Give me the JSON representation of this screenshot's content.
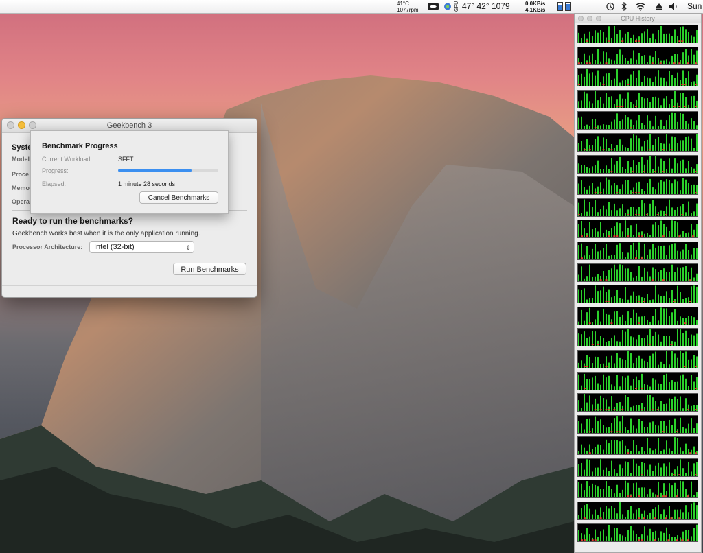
{
  "menubar": {
    "temp_top": "41°C",
    "temp_bottom": "1077rpm",
    "temps": "47° 42° 1079",
    "net_up": "0.0KB/s",
    "net_down": "4.1KB/s",
    "day": "Sun",
    "icons": [
      "nvidia-icon",
      "app-icon",
      "gpu-icon",
      "time-machine-icon",
      "bluetooth-icon",
      "wifi-icon",
      "eject-icon",
      "volume-icon"
    ]
  },
  "cpu_history": {
    "title": "CPU History",
    "core_count": 24,
    "bar_color": "#2bd12b"
  },
  "geekbench": {
    "title": "Geekbench 3",
    "system_heading": "Syste",
    "info_labels": [
      "Model",
      "Proce",
      "Memo",
      "Opera"
    ],
    "ready_heading": "Ready to run the benchmarks?",
    "ready_text": "Geekbench works best when it is the only application running.",
    "arch_label": "Processor Architecture:",
    "arch_value": "Intel (32-bit)",
    "run_button": "Run Benchmarks"
  },
  "progress": {
    "heading": "Benchmark Progress",
    "workload_label": "Current Workload:",
    "workload_value": "SFFT",
    "progress_label": "Progress:",
    "progress_fraction": 0.73,
    "elapsed_label": "Elapsed:",
    "elapsed_value": "1 minute 28 seconds",
    "cancel_button": "Cancel Benchmarks"
  },
  "colors": {
    "progress_fill": "#3b8ff0"
  }
}
